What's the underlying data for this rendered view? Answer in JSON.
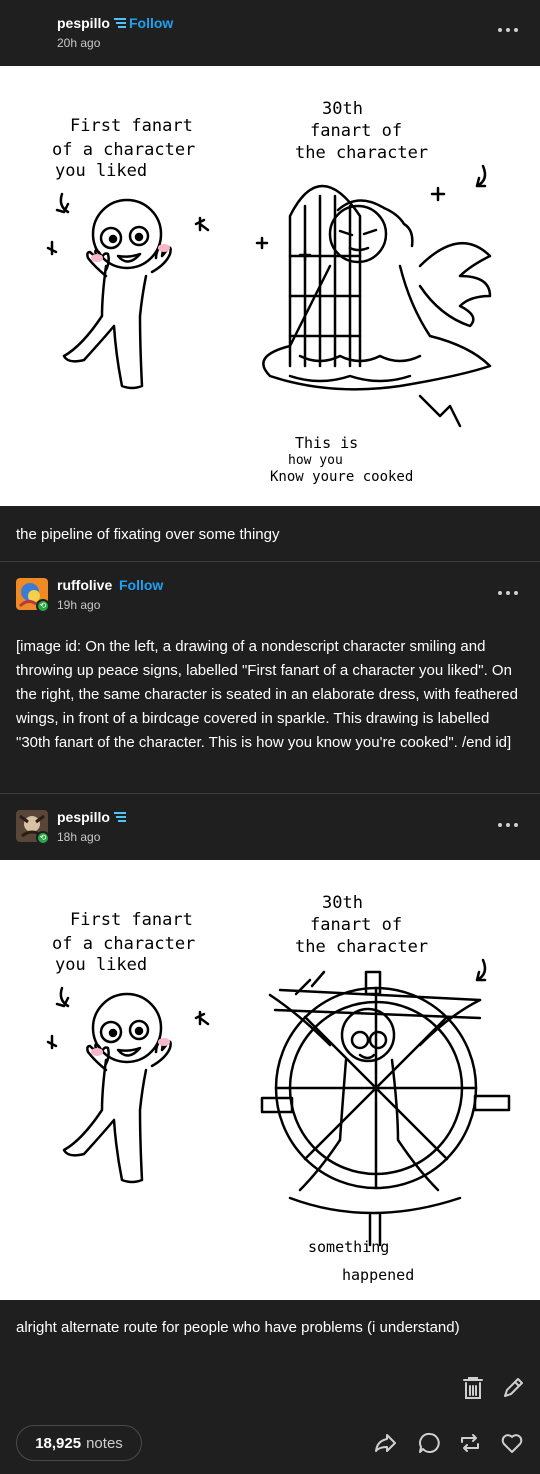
{
  "posts": [
    {
      "username": "pespillo",
      "follow_label": "Follow",
      "time": "20h ago",
      "art": {
        "left_label_lines": [
          "First fanart",
          "of a character",
          "you liked"
        ],
        "right_label_lines": [
          "30th",
          "fanart of",
          "the character"
        ],
        "bottom_label_lines": [
          "This is",
          "how you",
          "Know youre cooked"
        ]
      },
      "caption": "the pipeline of fixating over some thingy"
    },
    {
      "username": "ruffolive",
      "follow_label": "Follow",
      "time": "19h ago",
      "body": "[image id: On the left, a drawing of a nondescript character smiling and throwing up peace signs, labelled \"First fanart of a character you liked\". On the right, the same character is seated in an elaborate dress, with feathered wings, in front of a birdcage covered in sparkle. This drawing is labelled \"30th fanart of the character. This is how you know you're cooked\". /end id]"
    },
    {
      "username": "pespillo",
      "time": "18h ago",
      "art": {
        "left_label_lines": [
          "First fanart",
          "of a character",
          "you liked"
        ],
        "right_label_lines": [
          "30th",
          "fanart of",
          "the character"
        ],
        "bottom_label_lines": [
          "something",
          "happened"
        ]
      },
      "caption": "alright alternate route for people who have problems (i understand)"
    }
  ],
  "footer": {
    "notes_count": "18,925",
    "notes_label": "notes"
  },
  "icons": [
    "verified-icon",
    "more-icon",
    "delete-icon",
    "edit-icon",
    "share-icon",
    "reply-icon",
    "reblog-icon",
    "like-icon"
  ],
  "colors": {
    "background": "#1f1f1f",
    "follow": "#1da1f2",
    "badge": "#28a745"
  }
}
